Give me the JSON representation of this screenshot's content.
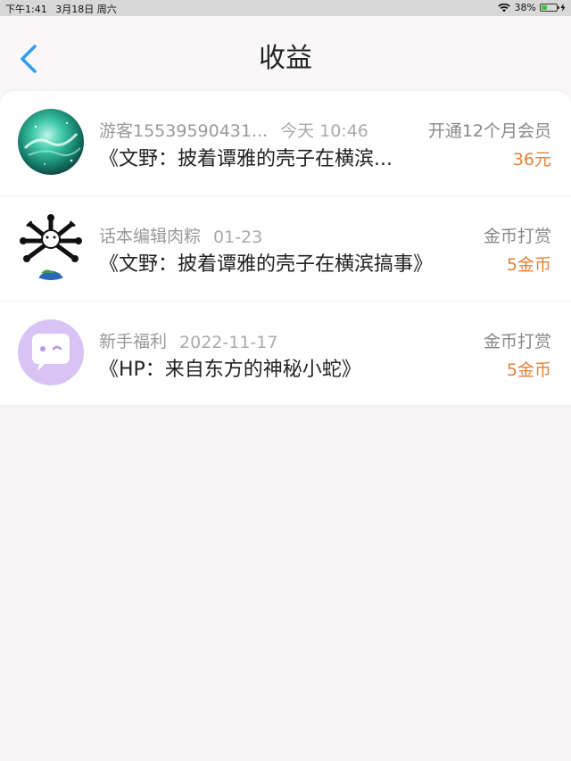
{
  "status_bar": {
    "time": "下午1:41",
    "date": "3月18日 周六",
    "battery_percent": "38%",
    "battery_level": 0.38,
    "battery_color": "#3cc43c"
  },
  "nav": {
    "title": "收益",
    "back_icon": "chevron-left-icon",
    "accent_color": "#2f9cf0"
  },
  "income_items": [
    {
      "user": "游客15539590431...",
      "time": "今天 10:46",
      "book": "《文野：披着谭雅的壳子在横滨...",
      "type": "开通12个月会员",
      "amount": "36元",
      "avatar": "nebula-avatar"
    },
    {
      "user": "话本编辑肉粽",
      "time": "01-23",
      "book": "《文野：披着谭雅的壳子在横滨搞事》",
      "type": "金币打赏",
      "amount": "5金币",
      "avatar": "earth-bones-avatar"
    },
    {
      "user": "新手福利",
      "time": "2022-11-17",
      "book": "《HP：来自东方的神秘小蛇》",
      "type": "金币打赏",
      "amount": "5金币",
      "avatar": "chat-bubble-avatar"
    }
  ],
  "amount_color": "#e5813a"
}
